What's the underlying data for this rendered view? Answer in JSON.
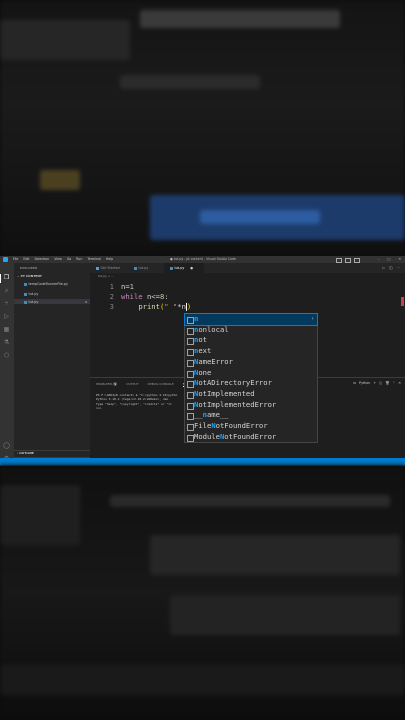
{
  "window": {
    "title": "● tut.py - pt content - Visual Studio Code",
    "menu": [
      "File",
      "Edit",
      "Selection",
      "View",
      "Go",
      "Run",
      "Terminal",
      "Help"
    ]
  },
  "sidebar": {
    "header": "EXPLORER",
    "section": "PY CONTENT",
    "files": [
      "tempCodeRunnerFile.py",
      "tut.py",
      "tut.py"
    ],
    "selected_badge": "9",
    "outline": "OUTLINE",
    "timeline": "TIMELINE"
  },
  "tabs": [
    {
      "label": "Get Started",
      "active": false
    },
    {
      "label": "tut.py",
      "active": false
    },
    {
      "label": "tut.py",
      "active": true,
      "close": "●"
    }
  ],
  "breadcrumb": "tut.py > ...",
  "editor": {
    "lines": [
      {
        "num": "1",
        "text": "n=1"
      },
      {
        "num": "2",
        "text": "while n<=8:"
      },
      {
        "num": "3",
        "text": "    print(\" \"*n"
      }
    ]
  },
  "suggestions": {
    "items": [
      {
        "pre": "",
        "hl": "n",
        "post": "",
        "icon": "abc",
        "selected": true
      },
      {
        "pre": "",
        "hl": "n",
        "post": "onlocal",
        "icon": "kw"
      },
      {
        "pre": "",
        "hl": "n",
        "post": "ot",
        "icon": "kw"
      },
      {
        "pre": "",
        "hl": "n",
        "post": "ext",
        "icon": "fn"
      },
      {
        "pre": "",
        "hl": "N",
        "post": "ameError",
        "icon": "cls"
      },
      {
        "pre": "",
        "hl": "N",
        "post": "one",
        "icon": "kw"
      },
      {
        "pre": "",
        "hl": "N",
        "post": "otADirectoryError",
        "icon": "cls"
      },
      {
        "pre": "",
        "hl": "N",
        "post": "otImplemented",
        "icon": "var"
      },
      {
        "pre": "",
        "hl": "N",
        "post": "otImplementedError",
        "icon": "cls"
      },
      {
        "pre": "__",
        "hl": "n",
        "post": "ame__",
        "icon": "var"
      },
      {
        "pre": "File",
        "hl": "N",
        "post": "otFoundError",
        "icon": "cls"
      },
      {
        "pre": "Module",
        "hl": "N",
        "post": "otFoundError",
        "icon": "cls"
      }
    ]
  },
  "panel": {
    "tabs": [
      "PROBLEMS",
      "OUTPUT",
      "DEBUG CONSOLE",
      "TERMINAL"
    ],
    "problems_count": "9",
    "shell": "Python",
    "terminal_lines": [
      "PS F:\\ADDIy8 content> & \"C:/python 3.10/pytho",
      "Python 3.10.2 (tags/v3.10.2:a58ebcc, Jan",
      "Type \"help\", \"copyright\", \"credits\" or \"li",
      ">>>"
    ]
  },
  "colors": {
    "accent": "#007acc",
    "editor_bg": "#1e1e1e",
    "suggest_highlight": "#18a3ff"
  }
}
